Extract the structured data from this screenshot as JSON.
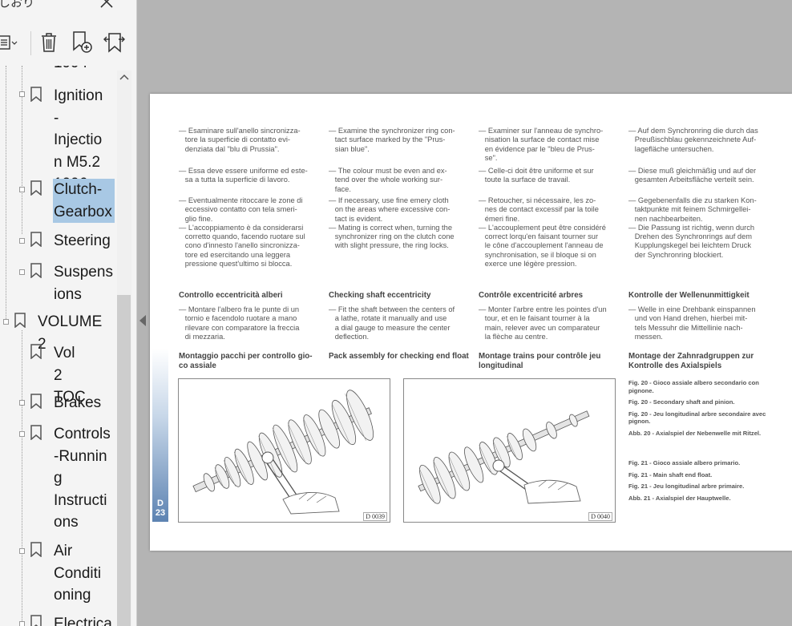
{
  "sidebar": {
    "title": "しおり",
    "tree": [
      {
        "label": "1994",
        "level": 1
      },
      {
        "label": "Ignition\n-Injectio\nn  M5.2\n1996",
        "level": 1
      },
      {
        "label": "Clutch-\nGearbox",
        "level": 1,
        "selected": true
      },
      {
        "label": "Steering",
        "level": 1
      },
      {
        "label": "Suspens\nions",
        "level": 1
      },
      {
        "label": "VOLUME 2",
        "level": 0
      },
      {
        "label": "Vol  2\nTOC",
        "level": 1
      },
      {
        "label": "Brakes",
        "level": 1
      },
      {
        "label": "Controls\n-Runnin\ng\nInstructi\nons",
        "level": 1
      },
      {
        "label": "Air\nConditi\noning",
        "level": 1
      },
      {
        "label": "Electrica",
        "level": 1
      }
    ]
  },
  "icons": [
    "close-icon",
    "options-menu-icon",
    "delete-icon",
    "add-bookmark-icon",
    "expand-bookmark-icon",
    "bookmark-icon",
    "scroll-up-icon",
    "collapse-panel-icon"
  ],
  "colors": {
    "selection": "#a8c8e4",
    "page_accent": "#5d83b2"
  },
  "page": {
    "col1": {
      "p1": "— Esaminare sull'anello sincronizza-\n   tore la superficie di contatto evi-\n   denziata dal \"blu di Prussia\".",
      "p2": "— Essa deve essere uniforme ed este-\n   sa a tutta la superficie di lavoro.",
      "p3": "— Eventualmente ritoccare le zone di\n   eccessivo contatto con tela smeri-\n   glio fine.\n— L'accoppiamento è da considerarsi\n   corretto quando, facendo ruotare sul\n   cono d'innesto l'anello sincronizza-\n   tore ed esercitando una leggera\n   pressione quest'ultimo si blocca.",
      "h1": "Controllo eccentricità alberi",
      "p4": "— Montare l'albero fra le punte di un\n   tornio e facendolo ruotare a mano\n   rilevare con comparatore la freccia\n   di mezzaria.",
      "h2": "Montaggio pacchi per controllo gio-\nco assiale"
    },
    "col2": {
      "p1": "— Examine the synchronizer ring con-\n   tact surface marked by the \"Prus-\n   sian blue\".",
      "p2": "— The colour must be even and ex-\n   tend over the whole working sur-\n   face.",
      "p3": "— If necessary, use fine emery cloth\n   on the areas where excessive con-\n   tact is evident.\n— Mating is correct when, turning the\n   synchronizer ring on the clutch cone\n   with slight pressure, the ring locks.",
      "h1": "Checking shaft eccentricity",
      "p4": "— Fit the shaft between the centers of\n   a lathe, rotate it manually and use\n   a dial gauge to measure the center\n   deflection.",
      "h2": "Pack assembly for checking end float"
    },
    "col3": {
      "p1": "— Examiner sur l'anneau de synchro-\n   nisation la surface de contact mise\n   en évidence par le \"bleu de Prus-\n   se\".",
      "p2": "— Celle-ci doit être uniforme et sur\n   toute la surface de travail.",
      "p3": "— Retoucher, si nécessaire, les zo-\n   nes de contact excessif par la toile\n   émeri fine.\n— L'accouplement peut être considéré\n   correct lorqu'en faisant tourner sur\n   le cône d'accouplement l'anneau de\n   synchronisation, se il bloque si on\n   exerce une légère pression.",
      "h1": "Contrôle excentricité arbres",
      "p4": "— Monter l'arbre entre les pointes d'un\n   tour, et en le faisant tourner à la\n   main, relever avec un comparateur\n   la flèche au centre.",
      "h2": "Montage trains pour contrôle jeu\nlongitudinal"
    },
    "col4": {
      "p1": "— Auf dem Synchronring die durch das\n   Preußischblau gekennzeichnete Auf-\n   lagefläche untersuchen.",
      "p2": "— Diese muß gleichmäßig und auf der\n   gesamten Arbeitsfläche verteilt sein.",
      "p3": "— Gegebenenfalls die zu starken Kon-\n   taktpunkte mit feinem Schmirgellei-\n   nen nachbearbeiten.\n— Die Passung ist richtig, wenn durch\n   Drehen des Synchronrings auf dem\n   Kupplungskegel bei leichtem Druck\n   der Synchronring blockiert.",
      "h1": "Kontrolle der Wellenunmittigkeit",
      "p4": "— Welle in eine Drehbank einspannen\n   und von Hand drehen, hierbei mit-\n   tels Messuhr die Mittellinie nach-\n   messen.",
      "h2": "Montage der Zahnradgruppen zur\nKontrolle des Axialspiels"
    },
    "captions": {
      "fig20": [
        "Fig. 20 - Gioco assiale albero secondario con pignone.",
        "Fig. 20 - Secondary shaft and pinion.",
        "Fig. 20 - Jeu longitudinal arbre secondaire avec pignon.",
        "Abb. 20 - Axialspiel der Nebenwelle mit Ritzel."
      ],
      "fig21": [
        "Fig. 21 - Gioco assiale albero primario.",
        "Fig. 21 - Main shaft end float.",
        "Fig. 21 - Jeu longitudinal arbre primaire.",
        "Abb. 21 - Axialspiel der Hauptwelle."
      ]
    },
    "figure_codes": [
      "D 0039",
      "D 0040"
    ],
    "section_letter": "D",
    "page_number": "23"
  }
}
